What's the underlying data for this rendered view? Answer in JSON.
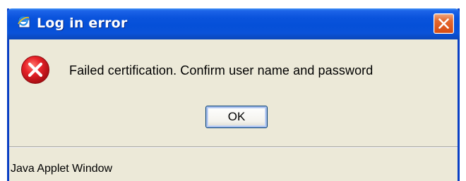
{
  "window": {
    "title": "Log in error",
    "title_icon": "internet-explorer-icon",
    "close_icon": "close-icon"
  },
  "dialog": {
    "icon": "error-icon",
    "message": "Failed certification. Confirm user name and password",
    "ok_label": "OK"
  },
  "status": {
    "text": "Java Applet Window"
  },
  "colors": {
    "titlebar": "#0a53dc",
    "window_border": "#0a3fc4",
    "close_button": "#d64b12",
    "dialog_background": "#ece9d8",
    "error_icon": "#e0141e"
  }
}
